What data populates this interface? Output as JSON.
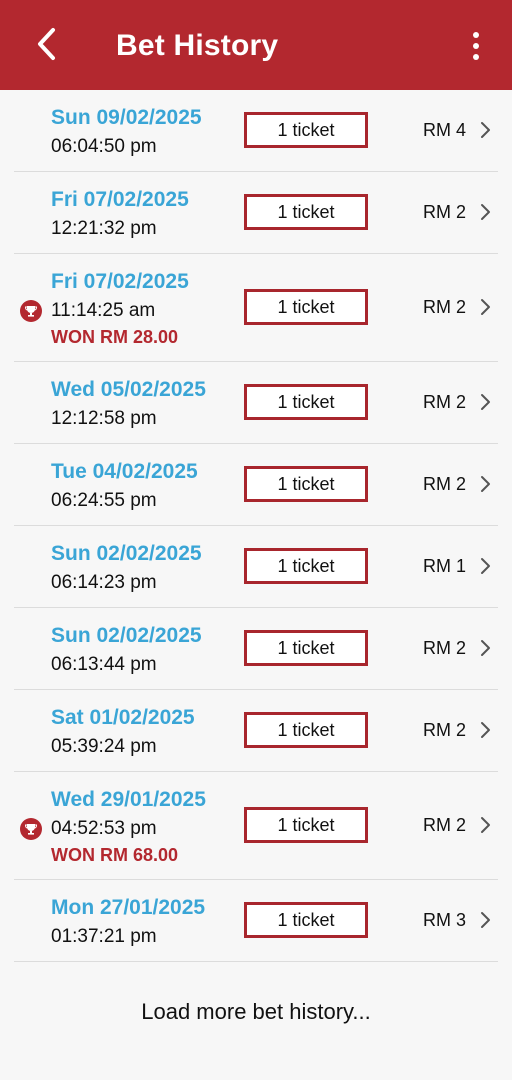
{
  "header": {
    "title": "Bet History",
    "back_icon": "chevron-left-icon",
    "menu_icon": "more-vert-icon"
  },
  "colors": {
    "header_bg": "#b3282f",
    "date_text": "#3aa5d6",
    "won_text": "#b3282f",
    "ticket_border": "#a8262d"
  },
  "bets": [
    {
      "date": "Sun 09/02/2025",
      "time": "06:04:50 pm",
      "tickets": "1 ticket",
      "amount": "RM 4",
      "won": false
    },
    {
      "date": "Fri 07/02/2025",
      "time": "12:21:32 pm",
      "tickets": "1 ticket",
      "amount": "RM 2",
      "won": false
    },
    {
      "date": "Fri 07/02/2025",
      "time": "11:14:25 am",
      "tickets": "1 ticket",
      "amount": "RM 2",
      "won": true,
      "won_text": "WON RM 28.00"
    },
    {
      "date": "Wed 05/02/2025",
      "time": "12:12:58 pm",
      "tickets": "1 ticket",
      "amount": "RM 2",
      "won": false
    },
    {
      "date": "Tue 04/02/2025",
      "time": "06:24:55 pm",
      "tickets": "1 ticket",
      "amount": "RM 2",
      "won": false
    },
    {
      "date": "Sun 02/02/2025",
      "time": "06:14:23 pm",
      "tickets": "1 ticket",
      "amount": "RM 1",
      "won": false
    },
    {
      "date": "Sun 02/02/2025",
      "time": "06:13:44 pm",
      "tickets": "1 ticket",
      "amount": "RM 2",
      "won": false
    },
    {
      "date": "Sat 01/02/2025",
      "time": "05:39:24 pm",
      "tickets": "1 ticket",
      "amount": "RM 2",
      "won": false
    },
    {
      "date": "Wed 29/01/2025",
      "time": "04:52:53 pm",
      "tickets": "1 ticket",
      "amount": "RM 2",
      "won": true,
      "won_text": "WON RM 68.00"
    },
    {
      "date": "Mon 27/01/2025",
      "time": "01:37:21 pm",
      "tickets": "1 ticket",
      "amount": "RM 3",
      "won": false
    }
  ],
  "footer": {
    "load_more": "Load more bet history..."
  }
}
